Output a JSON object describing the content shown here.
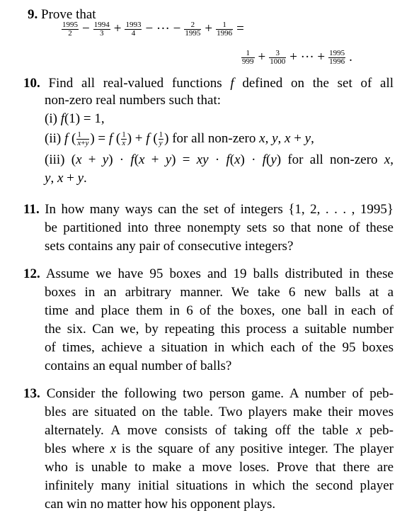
{
  "problems": [
    {
      "number": "9.",
      "intro": "Prove that",
      "eq_line1": {
        "terms": [
          {
            "n": "1995",
            "d": "2"
          },
          {
            "op": "−"
          },
          {
            "n": "1994",
            "d": "3"
          },
          {
            "op": "+"
          },
          {
            "n": "1993",
            "d": "4"
          },
          {
            "op": "− ··· −"
          },
          {
            "n": "2",
            "d": "1995"
          },
          {
            "op": "+"
          },
          {
            "n": "1",
            "d": "1996"
          },
          {
            "op": "="
          }
        ]
      },
      "eq_line2": {
        "terms": [
          {
            "n": "1",
            "d": "999"
          },
          {
            "op": "+"
          },
          {
            "n": "3",
            "d": "1000"
          },
          {
            "op": "+ ··· +"
          },
          {
            "n": "1995",
            "d": "1996"
          },
          {
            "op": "."
          }
        ]
      }
    },
    {
      "number": "10.",
      "lines": [
        "Find all real-valued functions f defined on the set of all",
        "non-zero real numbers such that:",
        "(i) f(1) = 1,",
        "(ii) f(1/(x+y)) = f(1/x) + f(1/y) for all non-zero x, y, x + y,",
        "(iii) (x + y) · f(x + y) = xy · f(x) · f(y) for all non-zero x,",
        "y, x + y."
      ]
    },
    {
      "number": "11.",
      "lines": [
        "In how many ways can the set of integers {1, 2, . . . , 1995}",
        "be partitioned into three nonempty sets so that none of these",
        "sets contains any pair of consecutive integers?"
      ]
    },
    {
      "number": "12.",
      "lines": [
        "Assume we have 95 boxes and 19 balls distributed in these",
        "boxes in an arbitrary manner.  We take 6 new balls at a",
        "time and place them in 6 of the boxes, one ball in each of",
        "the six. Can we, by repeating this process a suitable number",
        "of times, achieve a situation in which each of the 95 boxes",
        "contains an equal number of balls?"
      ]
    },
    {
      "number": "13.",
      "lines": [
        "Consider the following two person game. A number of peb-",
        "bles are situated on the table. Two players make their moves",
        "alternately.  A move consists of taking off the table x peb-",
        "bles where x is the square of any positive integer. The player",
        "who is unable to make a move loses. Prove that there are",
        "infinitely many initial situations in which the second player",
        "can win no matter how his opponent plays."
      ]
    }
  ]
}
